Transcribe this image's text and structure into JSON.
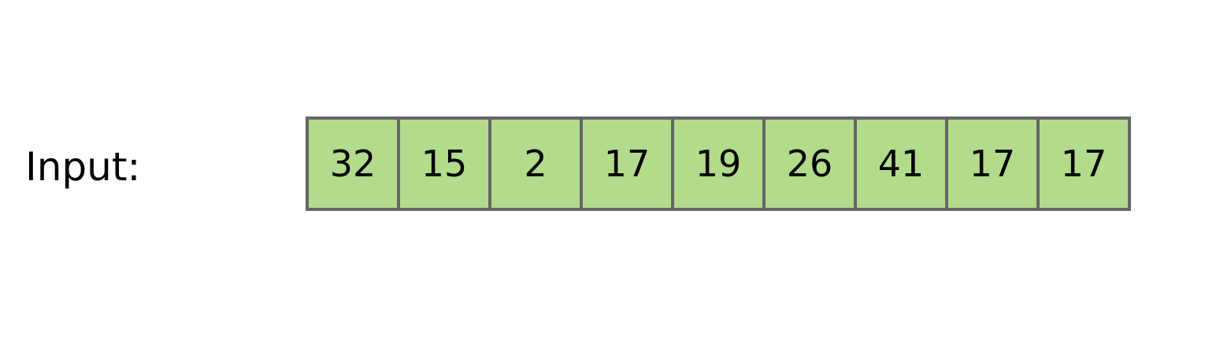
{
  "label": "Input:",
  "cell_color": "#b2db8c",
  "border_color": "#666666",
  "values": [
    "32",
    "15",
    "2",
    "17",
    "19",
    "26",
    "41",
    "17",
    "17"
  ]
}
